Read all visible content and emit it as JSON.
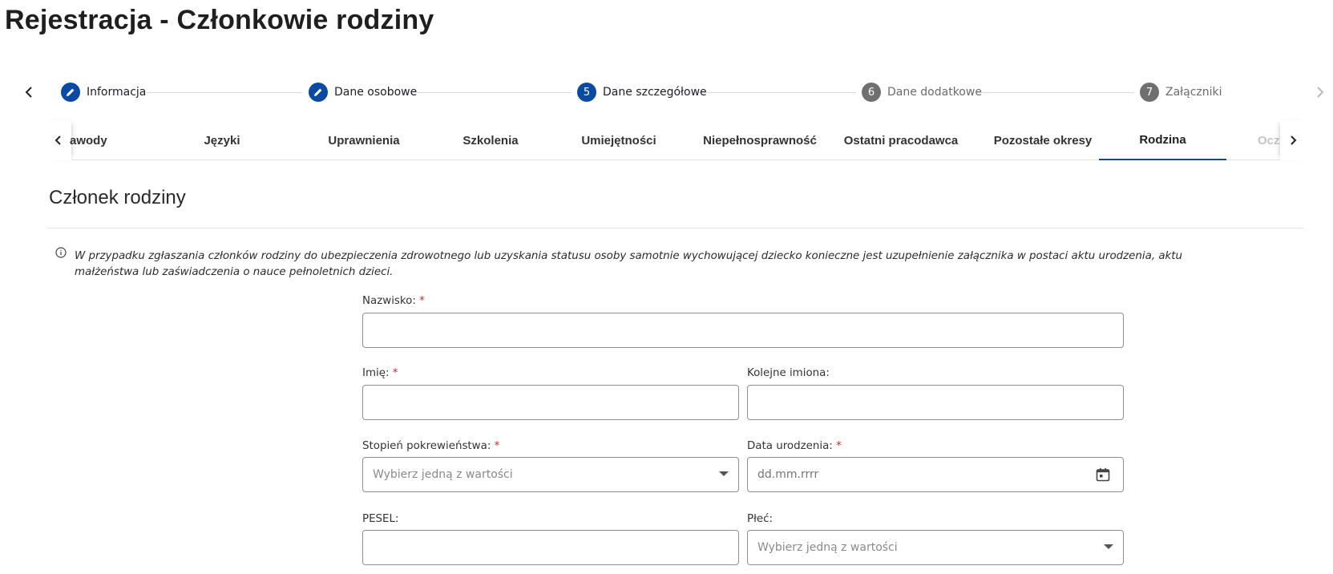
{
  "page": {
    "title": "Rejestracja - Członkowie rodziny"
  },
  "stepper": {
    "steps": [
      {
        "label": "Informacja",
        "marker": "",
        "state": "done"
      },
      {
        "label": "Dane osobowe",
        "marker": "",
        "state": "done"
      },
      {
        "label": "Dane szczegółowe",
        "marker": "5",
        "state": "active"
      },
      {
        "label": "Dane dodatkowe",
        "marker": "6",
        "state": "todo"
      },
      {
        "label": "Załączniki",
        "marker": "7",
        "state": "todo"
      }
    ]
  },
  "tabs": {
    "items": [
      {
        "label": "awody"
      },
      {
        "label": "Języki"
      },
      {
        "label": "Uprawnienia"
      },
      {
        "label": "Szkolenia"
      },
      {
        "label": "Umiejętności"
      },
      {
        "label": "Niepełnosprawność"
      },
      {
        "label": "Ostatni pracodawca"
      },
      {
        "label": "Pozostałe okresy"
      },
      {
        "label": "Rodzina"
      },
      {
        "label": "Ocz"
      }
    ],
    "active": "Rodzina"
  },
  "section": {
    "title": "Członek rodziny",
    "info": "W przypadku zgłaszania członków rodziny do ubezpieczenia zdrowotnego lub uzyskania statusu osoby samotnie wychowującej dziecko konieczne jest uzupełnienie załącznika w postaci aktu urodzenia, aktu małżeństwa lub zaświadczenia o nauce pełnoletnich dzieci."
  },
  "form": {
    "required_mark": "*",
    "nazwisko": {
      "label": "Nazwisko:",
      "value": ""
    },
    "imie": {
      "label": "Imię:",
      "value": ""
    },
    "kolejne_imiona": {
      "label": "Kolejne imiona:",
      "value": ""
    },
    "stopien": {
      "label": "Stopień pokrewieństwa:",
      "placeholder": "Wybierz jedną z wartości"
    },
    "data_urodzenia": {
      "label": "Data urodzenia:",
      "placeholder": "dd.mm.rrrr"
    },
    "pesel": {
      "label": "PESEL:",
      "value": ""
    },
    "plec": {
      "label": "Płeć:",
      "placeholder": "Wybierz jedną z wartości"
    }
  },
  "colors": {
    "accent": "#0b4aa2",
    "required": "#c62828",
    "todo_step": "#6f6f6f"
  },
  "icons": {
    "stepper_prev": "chevron-left-icon",
    "stepper_next": "chevron-right-icon",
    "done_step": "pencil-icon",
    "info": "info-icon",
    "calendar": "calendar-icon",
    "dropdown": "caret-down-icon"
  }
}
